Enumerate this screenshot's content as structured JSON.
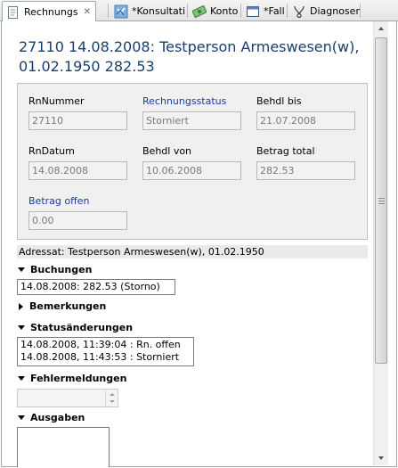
{
  "tabs": [
    {
      "label": "Rechnungs",
      "icon": "invoice-icon",
      "active": true,
      "close": "✕"
    },
    {
      "label": "*Konsultati",
      "icon": "consultation-icon"
    },
    {
      "label": "Konto",
      "icon": "money-icon"
    },
    {
      "label": "*Fall",
      "icon": "case-window-icon"
    },
    {
      "label": "Diagnosen",
      "icon": "diagnosis-icon"
    }
  ],
  "title": "27110 14.08.2008: Testperson Armeswesen(w), 01.02.1950 282.53",
  "fields": {
    "rnnummer": {
      "label": "RnNummer",
      "value": "27110"
    },
    "rechnungsstatus": {
      "label": "Rechnungsstatus",
      "value": "Storniert"
    },
    "behdl_bis": {
      "label": "Behdl bis",
      "value": "21.07.2008"
    },
    "rndatum": {
      "label": "RnDatum",
      "value": "14.08.2008"
    },
    "behdl_von": {
      "label": "Behdl von",
      "value": "10.06.2008"
    },
    "betrag_total": {
      "label": "Betrag total",
      "value": "282.53"
    },
    "betrag_offen": {
      "label": "Betrag offen",
      "value": "0.00"
    }
  },
  "adressat": "Adressat: Testperson Armeswesen(w), 01.02.1950",
  "sections": {
    "buchungen": {
      "label": "Buchungen",
      "items": [
        "14.08.2008: 282.53 (Storno)"
      ]
    },
    "bemerkungen": {
      "label": "Bemerkungen"
    },
    "statusaenderungen": {
      "label": "Statusänderungen",
      "items": [
        "14.08.2008, 11:39:04 : Rn. offen",
        "14.08.2008, 11:43:53 : Storniert"
      ]
    },
    "fehlermeldungen": {
      "label": "Fehlermeldungen"
    },
    "ausgaben": {
      "label": "Ausgaben"
    }
  },
  "colors": {
    "title": "#1a3e6e",
    "link_label": "#1a3aa6"
  }
}
